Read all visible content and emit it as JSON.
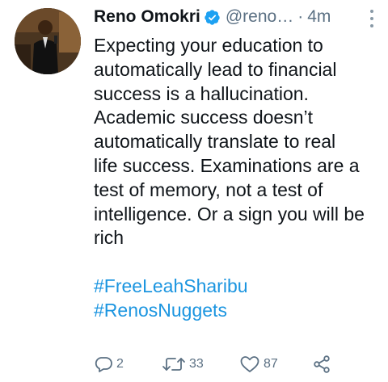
{
  "tweet": {
    "author_name": "Reno Omokri",
    "handle": "@reno…",
    "separator": "·",
    "time": "4m",
    "body_lines": [
      "Expecting your education to",
      "automatically lead to financial",
      "success is a hallucination.",
      "Academic success doesn’t",
      "automatically translate to real",
      "life success. Examinations are a",
      "test of memory, not a test of",
      "intelligence. Or a sign you will be",
      "rich"
    ],
    "hashtags": [
      "#FreeLeahSharibu",
      "#RenosNuggets"
    ],
    "actions": {
      "reply_count": "2",
      "retweet_count": "33",
      "like_count": "87"
    }
  },
  "icons": {
    "verified": "verified-badge-icon",
    "more": "more-vertical-icon",
    "reply": "reply-icon",
    "retweet": "retweet-icon",
    "like": "heart-icon",
    "share": "share-icon"
  },
  "colors": {
    "text": "#0f1419",
    "secondary": "#5b7083",
    "link": "#1b95e0",
    "verified": "#1da1f2"
  }
}
